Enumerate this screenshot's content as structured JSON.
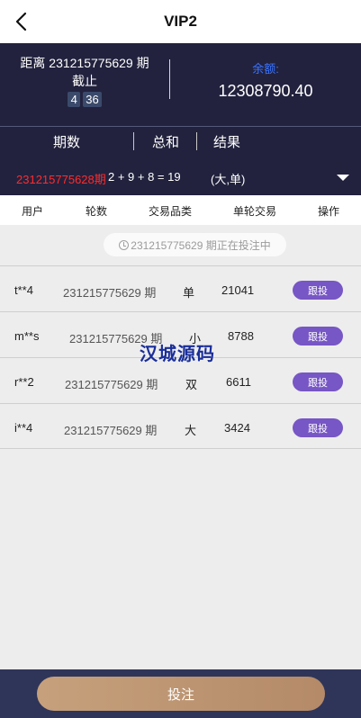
{
  "header": {
    "title": "VIP2"
  },
  "info": {
    "countdown_label": "距离 231215775629 期",
    "deadline_label": "截止",
    "minutes": "4",
    "seconds": "36",
    "balance_label": "余额:",
    "balance_value": "12308790.40"
  },
  "results": {
    "headers": {
      "period": "期数",
      "sum": "总和",
      "result": "结果"
    },
    "latest": {
      "period": "231215775628期",
      "sum": "2 + 9 + 8 = 19",
      "result": "(大,单)"
    }
  },
  "table": {
    "headers": [
      "用户",
      "轮数",
      "交易品类",
      "单轮交易",
      "操作"
    ],
    "notice": "231215775629 期正在投注中",
    "rows": [
      {
        "user": "t**4",
        "period": "231215775629 期",
        "type": "单",
        "amount": "21041",
        "action": "跟投"
      },
      {
        "user": "m**s",
        "period": "231215775629 期",
        "type": "小",
        "amount": "8788",
        "action": "跟投"
      },
      {
        "user": "r**2",
        "period": "231215775629 期",
        "type": "双",
        "amount": "6611",
        "action": "跟投"
      },
      {
        "user": "i**4",
        "period": "231215775629 期",
        "type": "大",
        "amount": "3424",
        "action": "跟投"
      }
    ]
  },
  "watermark": "汉城源码",
  "footer": {
    "bet_label": "投注"
  },
  "colors": {
    "header_bg": "#22223e",
    "accent_blue": "#3b74ff",
    "period_red": "#ff2b2b",
    "follow_button": "#7756c5",
    "footer_bg": "#2f3559",
    "bet_button": "#c6a07c"
  },
  "icons": {
    "back": "chevron-left-icon",
    "dropdown": "caret-down-icon",
    "notice": "clock-icon"
  }
}
